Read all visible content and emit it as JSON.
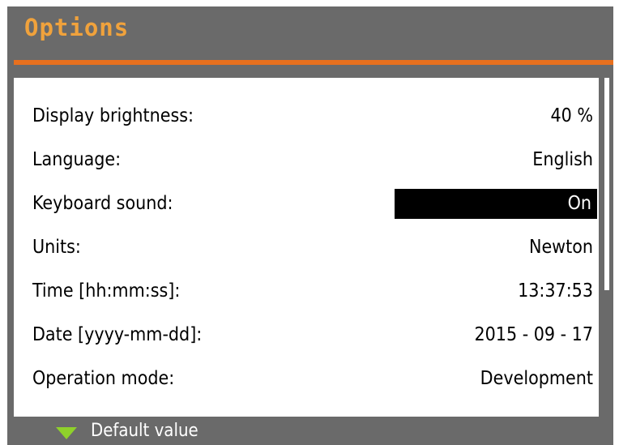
{
  "header": {
    "title": "Options",
    "title_color": "#f0a23c",
    "accent_color": "#e8701e"
  },
  "options": [
    {
      "label": "Display brightness:",
      "value": "40 %",
      "selected": false
    },
    {
      "label": "Language:",
      "value": "English",
      "selected": false
    },
    {
      "label": "Keyboard sound:",
      "value": "On",
      "selected": true
    },
    {
      "label": "Units:",
      "value": "Newton",
      "selected": false
    },
    {
      "label": "Time [hh:mm:ss]:",
      "value": "13:37:53",
      "selected": false
    },
    {
      "label": "Date [yyyy-mm-dd]:",
      "value": "2015 - 09 - 17",
      "selected": false
    },
    {
      "label": "Operation mode:",
      "value": "Development",
      "selected": false
    }
  ],
  "footer": {
    "icon": "triangle-down-icon",
    "icon_color": "#8fd12b",
    "label": "Default value"
  }
}
